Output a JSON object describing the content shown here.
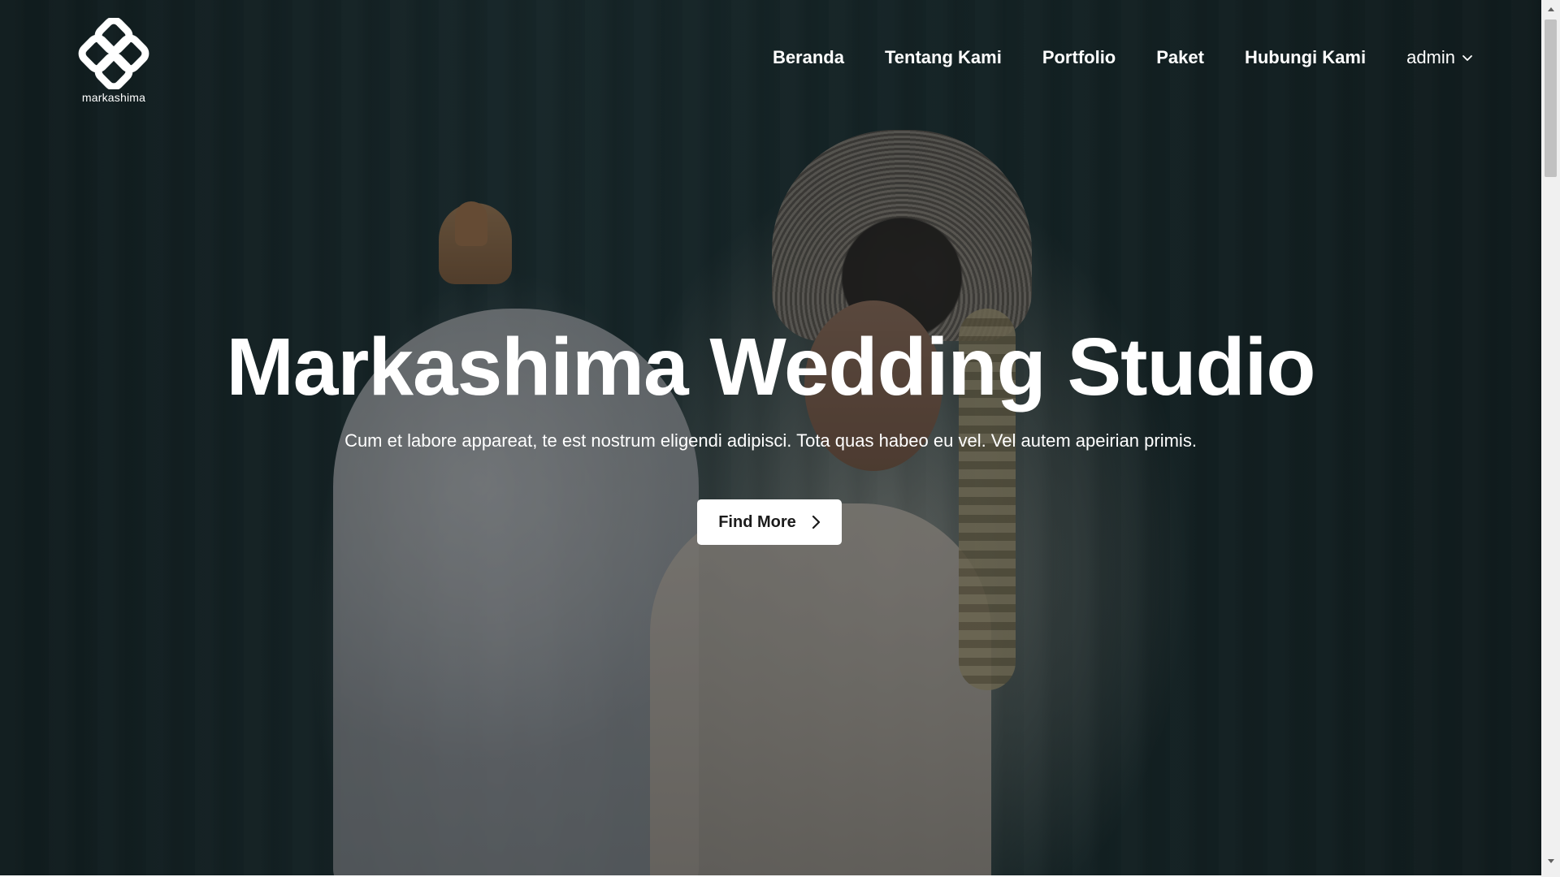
{
  "brand": {
    "name": "markashima"
  },
  "nav": {
    "items": [
      {
        "label": "Beranda"
      },
      {
        "label": "Tentang Kami"
      },
      {
        "label": "Portfolio"
      },
      {
        "label": "Paket"
      },
      {
        "label": "Hubungi Kami"
      }
    ],
    "user": {
      "label": "admin",
      "icon": "chevron-down-icon"
    }
  },
  "hero": {
    "title": "Markashima Wedding Studio",
    "subtitle": "Cum et labore appareat, te est nostrum eligendi adipisci. Tota quas habeo eu vel. Vel autem apeirian primis.",
    "cta_label": "Find More",
    "cta_icon": "chevron-right-icon"
  },
  "colors": {
    "overlay": "#000000",
    "nav_text": "#ffffff",
    "button_bg": "#ffffff",
    "button_text": "#1b1b1b"
  }
}
